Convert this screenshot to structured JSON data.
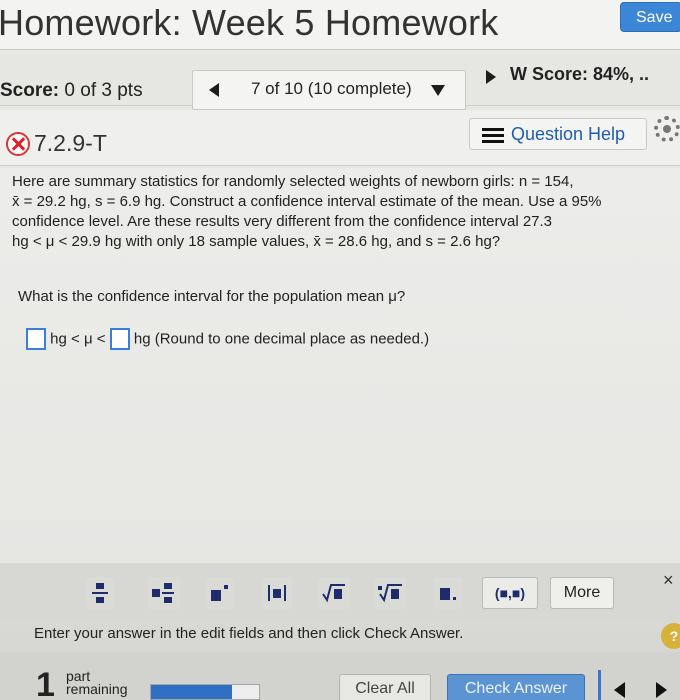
{
  "header": {
    "title": "Homework: Week 5 Homework",
    "save_label": "Save"
  },
  "score_bar": {
    "score_label": "Score:",
    "score_value": "0 of 3 pts",
    "nav_text": "7 of 10 (10 complete)",
    "hw_score": "W Score: 84%, .."
  },
  "question": {
    "number": "7.2.9-T",
    "help_label": "Question Help"
  },
  "content": {
    "statement_lines": [
      "Here are summary statistics for randomly selected weights of newborn girls: n = 154,",
      "x̄ = 29.2 hg, s = 6.9 hg. Construct a confidence interval estimate of the mean. Use a 95%",
      "confidence level. Are these results very different from the confidence interval 27.3",
      "hg < μ < 29.9 hg with only 18 sample values, x̄ = 28.6 hg, and s = 2.6 hg?"
    ],
    "ask": "What is the confidence interval for the population mean μ?",
    "answer_mid": "hg < μ <",
    "answer_tail": "hg (Round to one decimal place as needed.)"
  },
  "toolbar": {
    "paren_label": "(■,■)",
    "more_label": "More",
    "close_label": "×"
  },
  "instructions": "Enter your answer in the edit fields and then click Check Answer.",
  "footer": {
    "parts_number": "1",
    "parts_label": "part remaining",
    "progress": 0.75,
    "clear_label": "Clear All",
    "check_label": "Check Answer",
    "info_label": "?"
  },
  "colors": {
    "accent": "#3b86d6",
    "link": "#1f5ea8",
    "error": "#d33333"
  }
}
